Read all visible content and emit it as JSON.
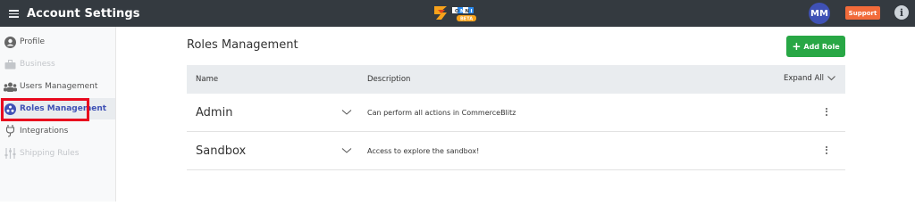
{
  "header": {
    "title": "Account Settings",
    "logo_text": "OMNI",
    "logo_badge": "BETA",
    "avatar_initials": "MM",
    "support_label": "Support",
    "info_glyph": "i"
  },
  "sidebar": {
    "items": [
      {
        "label": "Profile",
        "icon": "user-circle-icon",
        "state": "normal"
      },
      {
        "label": "Business",
        "icon": "briefcase-icon",
        "state": "disabled"
      },
      {
        "label": "Users Management",
        "icon": "users-icon",
        "state": "normal"
      },
      {
        "label": "Roles Management",
        "icon": "roles-icon",
        "state": "active"
      },
      {
        "label": "Integrations",
        "icon": "plug-icon",
        "state": "normal"
      },
      {
        "label": "Shipping Rules",
        "icon": "sliders-icon",
        "state": "disabled"
      }
    ]
  },
  "main": {
    "title": "Roles Management",
    "add_button_label": "Add Role",
    "table": {
      "columns": {
        "name": "Name",
        "description": "Description",
        "expand_all": "Expand All"
      },
      "rows": [
        {
          "name": "Admin",
          "description": "Can perform all actions in CommerceBlitz"
        },
        {
          "name": "Sandbox",
          "description": "Access to explore the sandbox!"
        }
      ]
    }
  },
  "colors": {
    "topbar": "#343a40",
    "accent": "#3f51b5",
    "add_button": "#28a745",
    "support": "#f26b3a",
    "highlight_outline": "#e8091e"
  }
}
